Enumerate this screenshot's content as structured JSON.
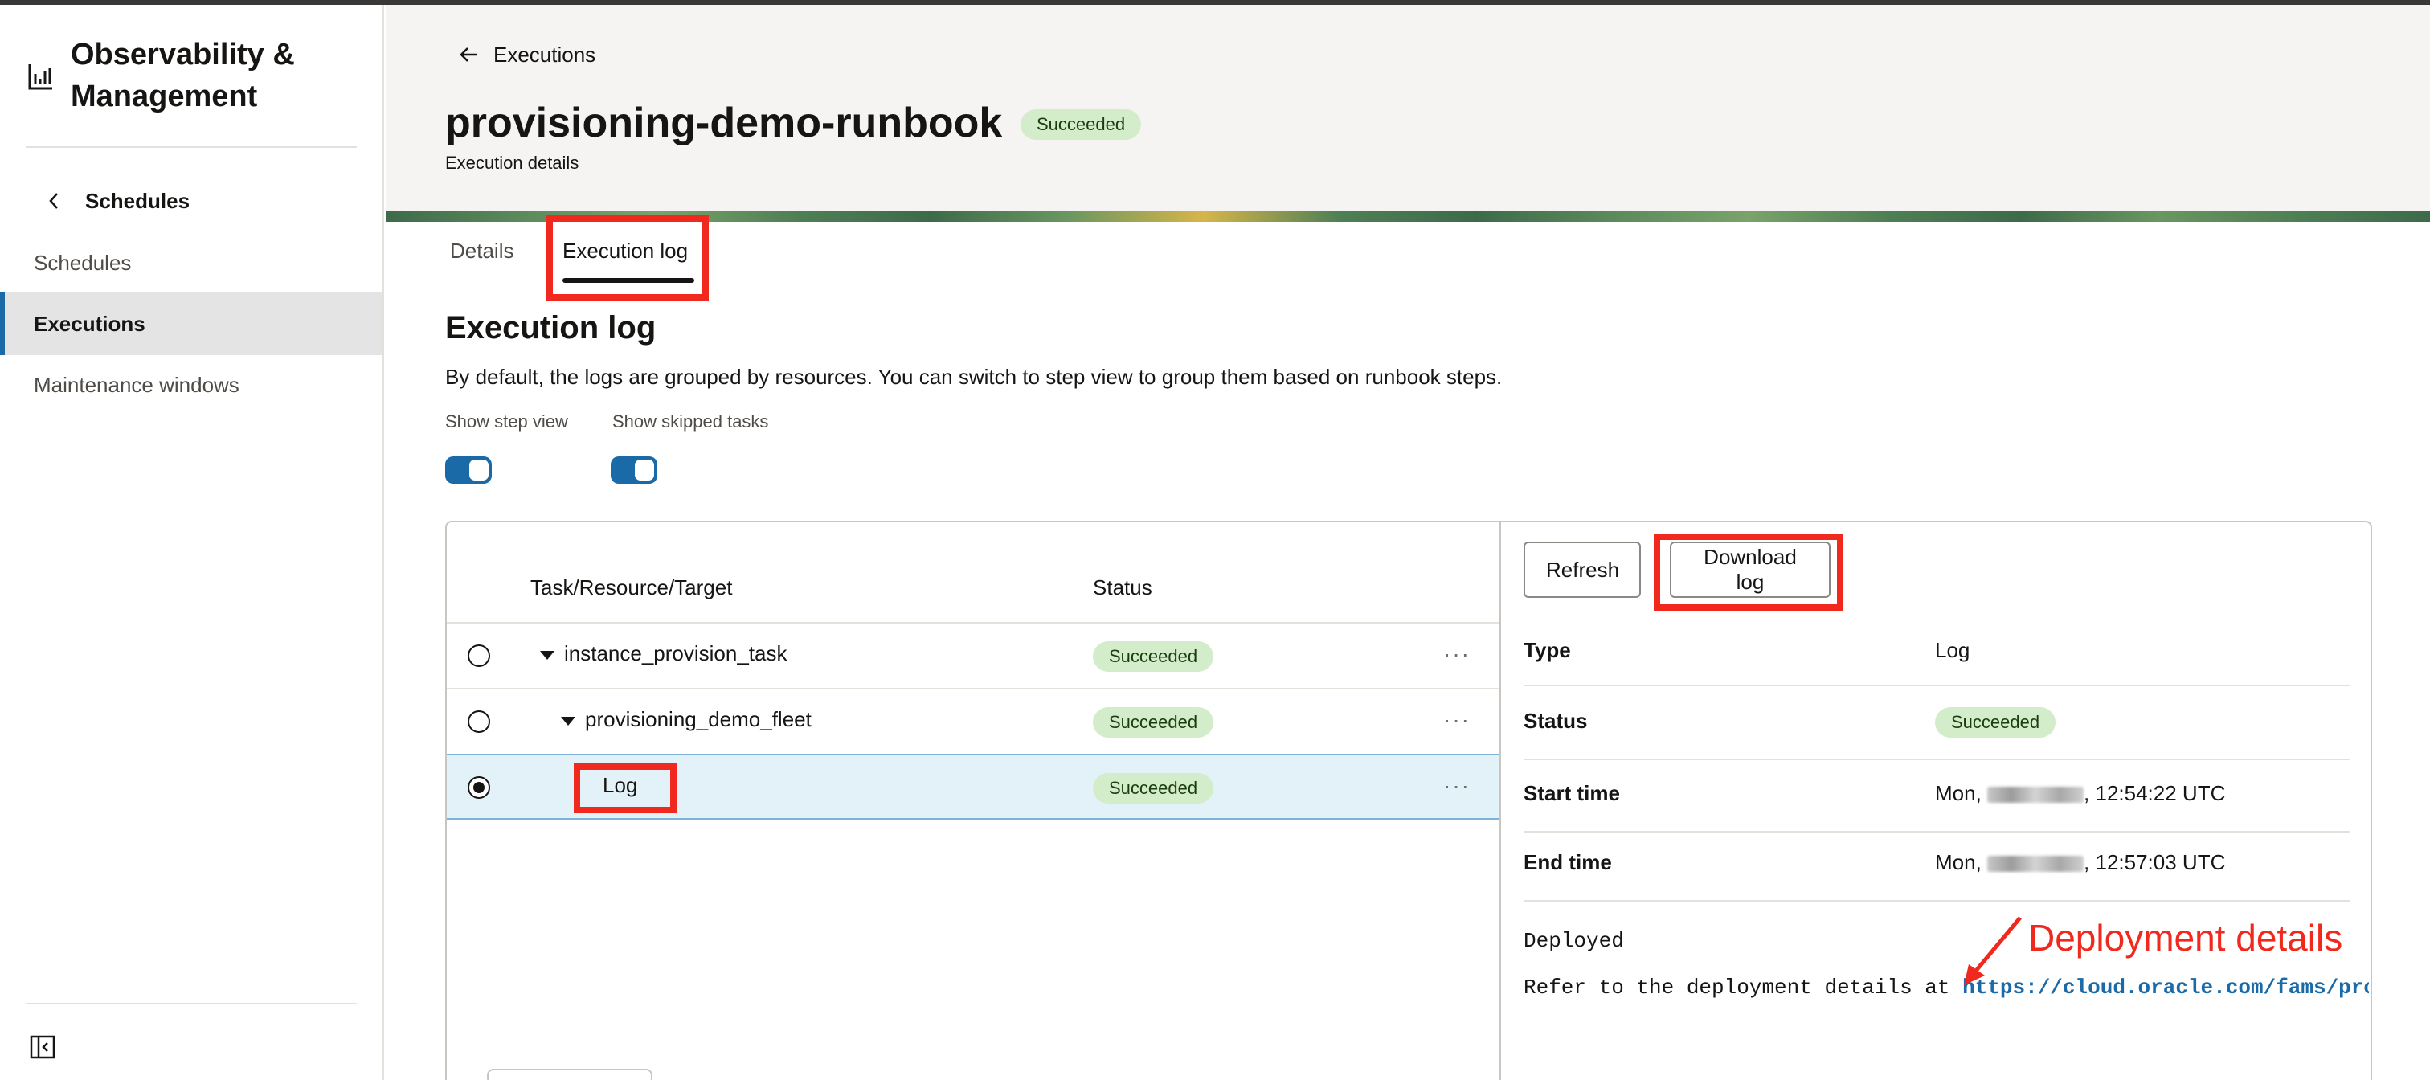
{
  "sidebar": {
    "app_title": "Observability & Management",
    "back_label": "Schedules",
    "items": [
      {
        "label": "Schedules",
        "active": false
      },
      {
        "label": "Executions",
        "active": true
      },
      {
        "label": "Maintenance windows",
        "active": false
      }
    ]
  },
  "header": {
    "breadcrumb": "Executions",
    "title": "provisioning-demo-runbook",
    "status": "Succeeded",
    "subtitle": "Execution details"
  },
  "tabs": [
    {
      "label": "Details",
      "active": false
    },
    {
      "label": "Execution log",
      "active": true
    }
  ],
  "section": {
    "title": "Execution log",
    "description": "By default, the logs are grouped by resources. You can switch to step view to group them based on runbook steps.",
    "toggles": [
      {
        "label": "Show step view",
        "on": true
      },
      {
        "label": "Show skipped tasks",
        "on": true
      }
    ]
  },
  "table": {
    "columns": [
      "Task/Resource/Target",
      "Status"
    ],
    "rows": [
      {
        "name": "instance_provision_task",
        "status": "Succeeded",
        "level": 0,
        "expanded": true,
        "selected": false
      },
      {
        "name": "provisioning_demo_fleet",
        "status": "Succeeded",
        "level": 1,
        "expanded": true,
        "selected": false
      },
      {
        "name": "Log",
        "status": "Succeeded",
        "level": 2,
        "expanded": false,
        "selected": true
      }
    ]
  },
  "detail": {
    "refresh_label": "Refresh",
    "download_label": "Download log",
    "fields": [
      {
        "key": "Type",
        "value": "Log"
      },
      {
        "key": "Status",
        "value": "Succeeded"
      },
      {
        "key": "Start time",
        "value_prefix": "Mon,",
        "value_suffix": ", 12:54:22 UTC"
      },
      {
        "key": "End time",
        "value_prefix": "Mon,",
        "value_suffix": ", 12:57:03 UTC"
      }
    ],
    "log_line_1": "Deployed",
    "log_line_2_prefix": "Refer to the deployment details at ",
    "log_line_2_link": "https://cloud.oracle.com/fams/prov"
  },
  "annotation": {
    "label": "Deployment details",
    "color": "#f0281e"
  },
  "colors": {
    "accent": "#1a6aa8",
    "success_badge_bg": "#d3ecc9",
    "highlight": "#f0281e"
  }
}
